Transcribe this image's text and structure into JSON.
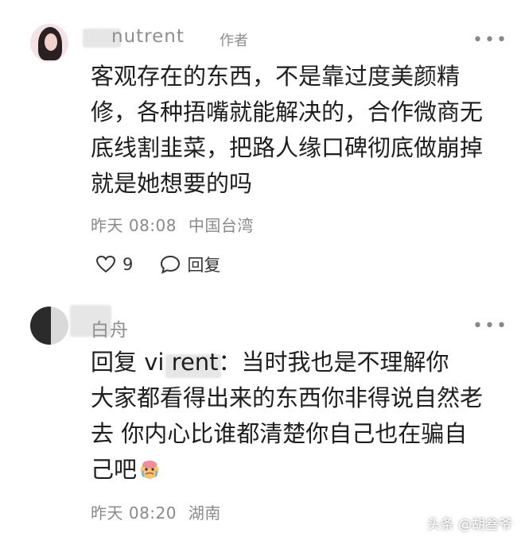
{
  "comments": [
    {
      "username": "nutrent",
      "author_badge": "作者",
      "text_lines": [
        "客观存在的东西，不是靠过度美颜精",
        "修，各种捂嘴就能解决的，合作微商无",
        "底线割韭菜，把路人缘口碑彻底做崩掉",
        "就是她想要的吗"
      ],
      "time": "昨天 08:08",
      "location": "中国台湾",
      "like_count": "9",
      "reply_label": "回复"
    },
    {
      "username": "白舟",
      "text_lines": [
        "回复 vi    rent：当时我也是不理解你",
        "大家都看得出来的东西你非得说自然老",
        "去 你内心比谁都清楚你自己也在骗自",
        "己吧"
      ],
      "time": "昨天 08:20",
      "location": "湖南"
    }
  ],
  "icons": {
    "more": "more-icon",
    "like": "heart-icon",
    "reply": "comment-bubble-icon",
    "emoji": "crying-emoji-icon"
  },
  "watermark": "头条 @胡叁爷",
  "colors": {
    "text": "#1e1e1e",
    "meta": "#8a8a8a",
    "username": "#8e8e8e"
  }
}
